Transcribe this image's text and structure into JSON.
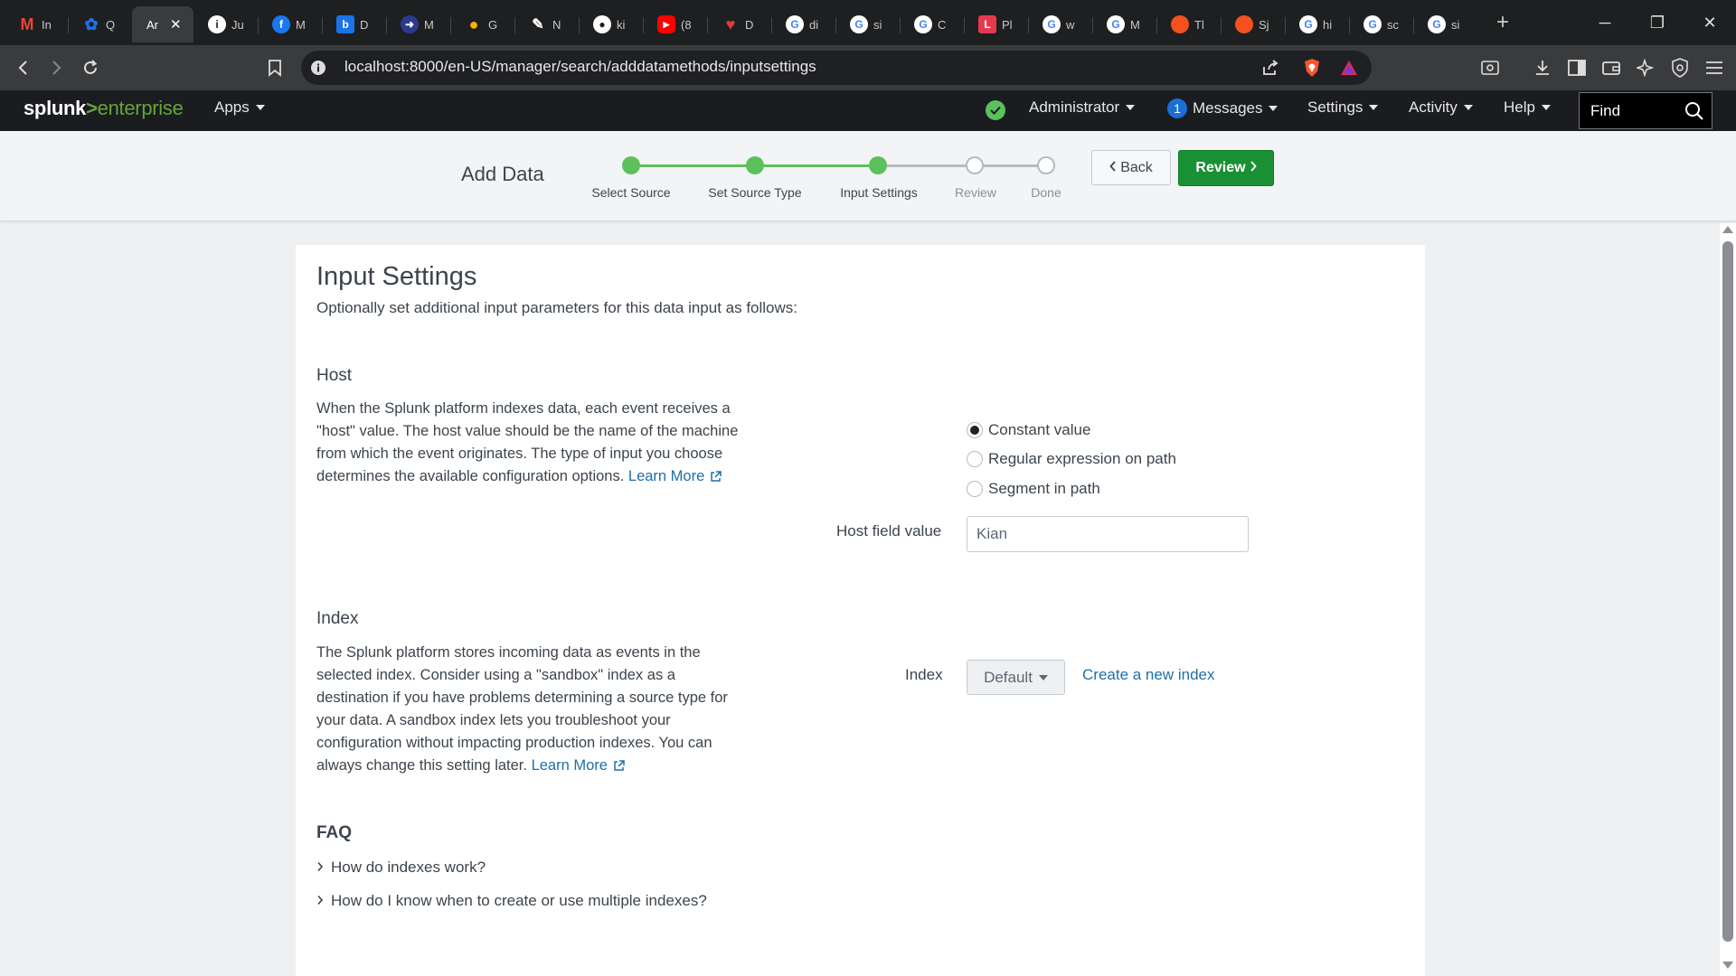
{
  "browser": {
    "tabs": [
      {
        "title": "In",
        "icon": "gmail-icon",
        "color": "#ea4335",
        "glyph": "M"
      },
      {
        "title": "Q",
        "icon": "settings-gear-icon",
        "color": "#1a73e8",
        "glyph": "✿"
      },
      {
        "title": "Ar",
        "icon": "splunk-tab-icon",
        "color": "#3a3b3d",
        "glyph": "",
        "active": true
      },
      {
        "title": "Ju",
        "icon": "info-icon",
        "color": "#5f6368",
        "glyph": "i"
      },
      {
        "title": "M",
        "icon": "facebook-icon",
        "color": "#1877f2",
        "glyph": "f"
      },
      {
        "title": "D",
        "icon": "bing-icon",
        "color": "#1a73e8",
        "glyph": "b"
      },
      {
        "title": "M",
        "icon": "arrow-app-icon",
        "color": "#3b5bdb",
        "glyph": "➜"
      },
      {
        "title": "G",
        "icon": "bulb-icon",
        "color": "#f4b400",
        "glyph": "●"
      },
      {
        "title": "N",
        "icon": "pen-icon",
        "color": "#1e1f20",
        "glyph": "✎"
      },
      {
        "title": "ki",
        "icon": "github-icon",
        "color": "#1e1f20",
        "glyph": "●"
      },
      {
        "title": "(8",
        "icon": "youtube-icon",
        "color": "#ff0000",
        "glyph": "▶"
      },
      {
        "title": "D",
        "icon": "heart-icon",
        "color": "#e53935",
        "glyph": "♥"
      },
      {
        "title": "di",
        "icon": "google-icon",
        "color": "#ffffff",
        "glyph": "G"
      },
      {
        "title": "si",
        "icon": "google-icon",
        "color": "#ffffff",
        "glyph": "G"
      },
      {
        "title": "C",
        "icon": "google-icon",
        "color": "#ffffff",
        "glyph": "G"
      },
      {
        "title": "Pl",
        "icon": "pl-icon",
        "color": "#e53950",
        "glyph": "L"
      },
      {
        "title": "w",
        "icon": "google-icon",
        "color": "#ffffff",
        "glyph": "G"
      },
      {
        "title": "M",
        "icon": "google-icon",
        "color": "#ffffff",
        "glyph": "G"
      },
      {
        "title": "Tl",
        "icon": "orange-ball-icon",
        "color": "#f4511e",
        "glyph": "●"
      },
      {
        "title": "Sj",
        "icon": "orange-ball-icon",
        "color": "#f4511e",
        "glyph": "●"
      },
      {
        "title": "hi",
        "icon": "google-icon",
        "color": "#ffffff",
        "glyph": "G"
      },
      {
        "title": "sc",
        "icon": "google-icon",
        "color": "#ffffff",
        "glyph": "G"
      },
      {
        "title": "si",
        "icon": "google-icon",
        "color": "#ffffff",
        "glyph": "G"
      }
    ],
    "url": "localhost:8000/en-US/manager/search/adddatamethods/inputsettings"
  },
  "splunk_bar": {
    "logo_brand": "splunk",
    "logo_gt": ">",
    "logo_product": "enterprise",
    "apps_label": "Apps",
    "user_label": "Administrator",
    "messages_count": "1",
    "messages_label": "Messages",
    "settings_label": "Settings",
    "activity_label": "Activity",
    "help_label": "Help",
    "find_placeholder": "Find"
  },
  "wizard": {
    "title": "Add Data",
    "steps": [
      {
        "label": "Select Source",
        "status": "complete"
      },
      {
        "label": "Set Source Type",
        "status": "complete"
      },
      {
        "label": "Input Settings",
        "status": "current"
      },
      {
        "label": "Review",
        "status": "pending"
      },
      {
        "label": "Done",
        "status": "pending"
      }
    ],
    "back_label": "Back",
    "review_label": "Review",
    "colors": {
      "complete": "#5cc05c",
      "pending": "#b5bbc0",
      "primary_button": "#1a9035"
    }
  },
  "page": {
    "title": "Input Settings",
    "subtitle": "Optionally set additional input parameters for this data input as follows:"
  },
  "host": {
    "heading": "Host",
    "description_lines": [
      "When the Splunk platform indexes data, each event receives a",
      "\"host\" value. The host value should be the name of the machine",
      "from which the event originates. The type of input you choose",
      "determines the available configuration options."
    ],
    "learn_more": "Learn More",
    "options": [
      {
        "label": "Constant value",
        "selected": true
      },
      {
        "label": "Regular expression on path",
        "selected": false
      },
      {
        "label": "Segment in path",
        "selected": false
      }
    ],
    "field_label": "Host field value",
    "field_value": "Kian"
  },
  "index": {
    "heading": "Index",
    "description_lines": [
      "The Splunk platform stores incoming data as events in the",
      "selected index. Consider using a \"sandbox\" index as a",
      "destination if you have problems determining a source type for",
      "your data. A sandbox index lets you troubleshoot your",
      "configuration without impacting production indexes. You can",
      "always change this setting later."
    ],
    "learn_more": "Learn More",
    "field_label": "Index",
    "selected_value": "Default",
    "create_link": "Create a new index"
  },
  "faq": {
    "title": "FAQ",
    "items": [
      "How do indexes work?",
      "How do I know when to create or use multiple indexes?"
    ]
  }
}
